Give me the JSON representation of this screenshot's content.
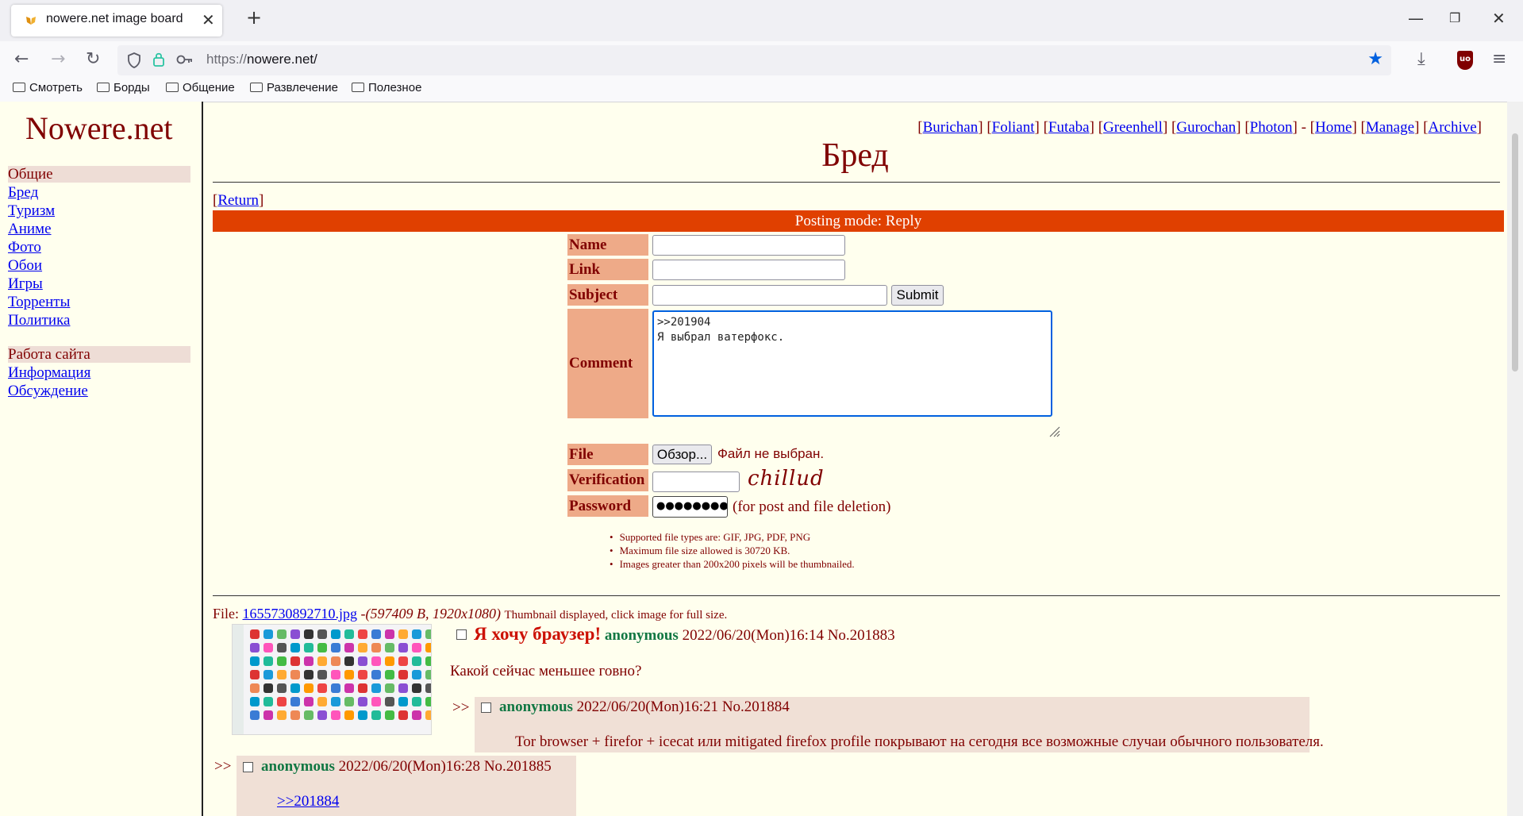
{
  "browser": {
    "tab_title": "nowere.net image board",
    "url_scheme": "https://",
    "url_host": "nowere.net/",
    "bookmarks": [
      "Смотреть",
      "Борды",
      "Общение",
      "Развлечение",
      "Полезное"
    ]
  },
  "sidebar": {
    "logo": "Nowere.net",
    "section1": "Общие",
    "links1": [
      "Бред",
      "Туризм",
      "Аниме",
      "Фото",
      "Обои",
      "Игры",
      "Торренты",
      "Политика"
    ],
    "section2": "Работа сайта",
    "links2": [
      "Информация",
      "Обсуждение"
    ]
  },
  "header": {
    "links": [
      "Burichan",
      "Foliant",
      "Futaba",
      "Greenhell",
      "Gurochan",
      "Photon"
    ],
    "nav": [
      "Home",
      "Manage",
      "Archive"
    ],
    "board_title": "Бред"
  },
  "form": {
    "return_label": "Return",
    "mode": "Posting mode: Reply",
    "name_label": "Name",
    "link_label": "Link",
    "subject_label": "Subject",
    "submit_label": "Submit",
    "comment_label": "Comment",
    "comment_line1": ">>201904",
    "comment_line2": "Я выбрал ватерфокс.",
    "file_label": "File",
    "browse_label": "Обзор...",
    "no_file": "Файл не выбран.",
    "verification_label": "Verification",
    "captcha_text": "chillud",
    "password_label": "Password",
    "password_value": "●●●●●●●●",
    "password_note": "(for post and file deletion)",
    "rules": [
      "Supported file types are: GIF, JPG, PDF, PNG",
      "Maximum file size allowed is 30720 KB.",
      "Images greater than 200x200 pixels will be thumbnailed."
    ]
  },
  "thread": {
    "file_prefix": "File:",
    "file_name": "1655730892710.jpg",
    "file_meta": "-(597409 B, 1920x1080)",
    "thumb_note": "Thumbnail displayed, click image for full size.",
    "op": {
      "subject": "Я хочу браузер!",
      "poster": "anonymous",
      "date": "2022/06/20(Mon)16:14",
      "number": "No.201883",
      "text": "Какой сейчас меньшее говно?"
    },
    "reply1": {
      "poster": "anonymous",
      "date": "2022/06/20(Mon)16:21",
      "number": "No.201884",
      "text": "Tor browser + firefor + icecat или mitigated firefox profile покрывают на сегодня все возможные случаи обычного пользователя."
    },
    "reply2": {
      "poster": "anonymous",
      "date": "2022/06/20(Mon)16:28",
      "number": "No.201885",
      "ref": ">>201884"
    },
    "arrows": ">>"
  },
  "colors": {
    "mode_bar": "#e04000",
    "label_bg": "#eeaa88",
    "reply_bg": "#f0e0d6",
    "page_bg": "#ffffee"
  }
}
